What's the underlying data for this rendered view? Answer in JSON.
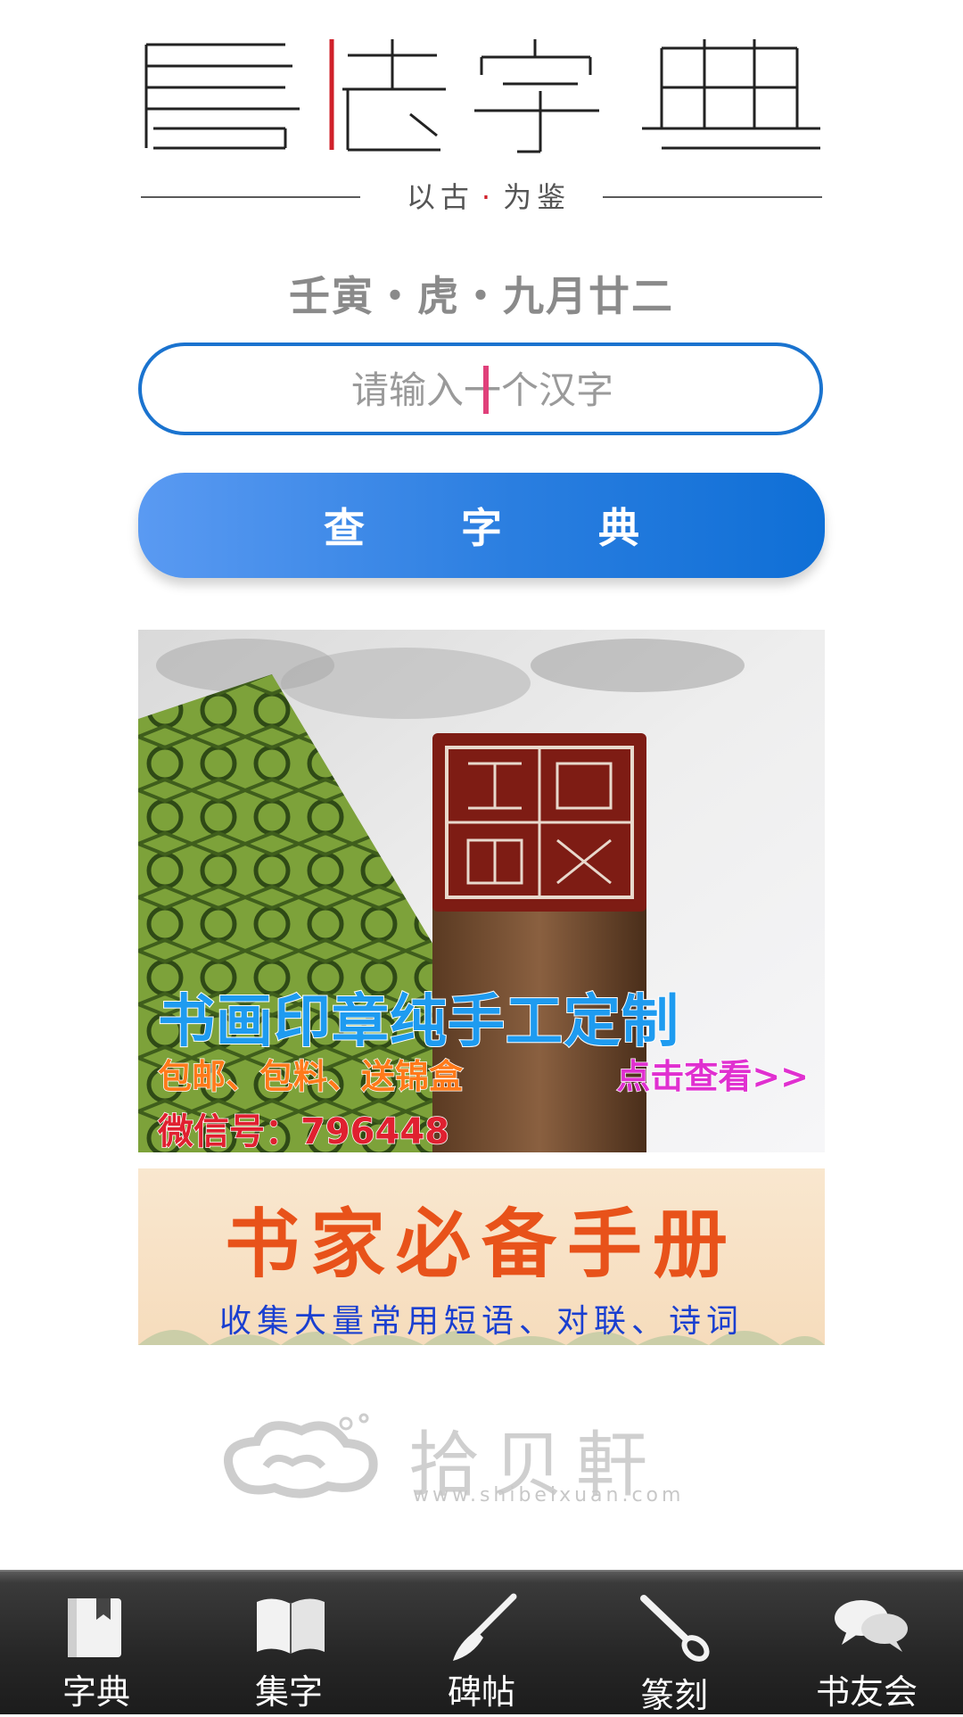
{
  "header": {
    "logo_text": "書法字典",
    "tagline_a": "以古",
    "tagline_b": "为鉴"
  },
  "date": "壬寅・虎・九月廿二",
  "search": {
    "placeholder": "请输入一个汉字",
    "value": ""
  },
  "query_button": "查字典",
  "ad1": {
    "title": "书画印章纯手工定制",
    "subtitle": "包邮、包料、送锦盒",
    "link": "点击查看>>",
    "wechat": "微信号：796448"
  },
  "ad2": {
    "title": "书家必备手册",
    "subtitle": "收集大量常用短语、对联、诗词"
  },
  "brand": {
    "name": "拾贝軒",
    "url": "www.shibeixuan.com"
  },
  "nav": {
    "items": [
      {
        "label": "字典",
        "icon": "book-icon"
      },
      {
        "label": "集字",
        "icon": "open-book-icon"
      },
      {
        "label": "碑帖",
        "icon": "brush-icon"
      },
      {
        "label": "篆刻",
        "icon": "carving-knife-icon"
      },
      {
        "label": "书友会",
        "icon": "chat-bubbles-icon"
      }
    ]
  },
  "colors": {
    "accent_blue": "#1a73cf",
    "button_gradient_start": "#5a9af2",
    "button_gradient_end": "#0f6fd6",
    "logo_red": "#d0202a",
    "nav_bg": "#262626"
  }
}
